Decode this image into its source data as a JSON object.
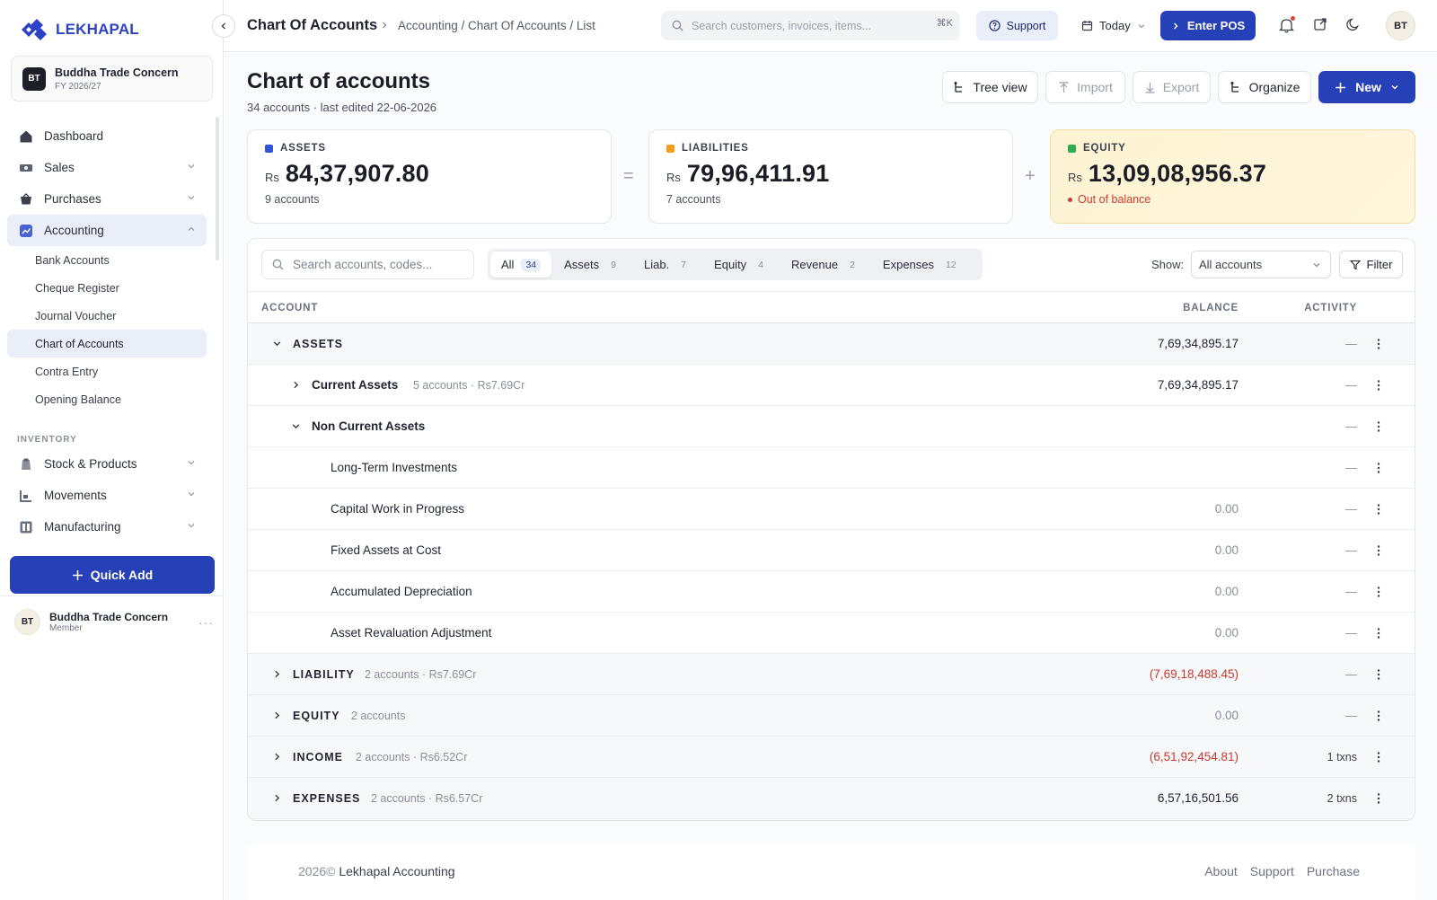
{
  "app": {
    "logo_text": "LEKHAPAL",
    "org_initials": "BT",
    "org_name": "Buddha Trade Concern",
    "fiscal_year": "FY 2026/27"
  },
  "sidebar": {
    "nav": [
      {
        "label": "Dashboard",
        "icon": "home-icon"
      },
      {
        "label": "Sales",
        "icon": "sales-icon"
      },
      {
        "label": "Purchases",
        "icon": "basket-icon"
      },
      {
        "label": "Accounting",
        "icon": "chart-icon"
      }
    ],
    "accounting_sub": [
      "Bank Accounts",
      "Cheque Register",
      "Journal Voucher",
      "Chart of Accounts",
      "Contra Entry",
      "Opening Balance"
    ],
    "section_inventory": "INVENTORY",
    "inventory": [
      {
        "label": "Stock & Products",
        "icon": "box-icon"
      },
      {
        "label": "Movements",
        "icon": "movements-icon"
      },
      {
        "label": "Manufacturing",
        "icon": "factory-icon"
      }
    ],
    "quick_add": "Quick Add",
    "user": {
      "initials": "BT",
      "name": "Buddha Trade Concern",
      "role": "Member",
      "more": "···"
    }
  },
  "topbar": {
    "title": "Chart Of Accounts",
    "path": "Accounting / Chart Of Accounts / List",
    "search_placeholder": "Search customers, invoices, items...",
    "search_shortcut": "⌘K",
    "support": "Support",
    "date_filter": "Today",
    "enter_pos": "Enter POS",
    "avatar": "BT"
  },
  "page": {
    "title": "Chart of accounts",
    "subtitle": "34 accounts · last edited 22-06-2026",
    "buttons": {
      "tree_view": "Tree view",
      "import": "Import",
      "export": "Export",
      "organize": "Organize",
      "new": "New"
    }
  },
  "summary": {
    "currency": "Rs",
    "assets": {
      "label": "ASSETS",
      "amount": "84,37,907.80",
      "sub": "9  accounts",
      "color": "#2f54d6"
    },
    "liabilities": {
      "label": "LIABILITIES",
      "amount": "79,96,411.91",
      "sub": "7  accounts",
      "color": "#f39c1a"
    },
    "equity": {
      "label": "EQUITY",
      "amount": "13,09,08,956.37",
      "warning": "Out of balance",
      "color": "#2fae4e"
    },
    "op_equals": "=",
    "op_plus": "+"
  },
  "table": {
    "search_placeholder": "Search accounts, codes...",
    "tabs": [
      {
        "label": "All",
        "count": "34"
      },
      {
        "label": "Assets",
        "count": "9"
      },
      {
        "label": "Liab.",
        "count": "7"
      },
      {
        "label": "Equity",
        "count": "4"
      },
      {
        "label": "Revenue",
        "count": "2"
      },
      {
        "label": "Expenses",
        "count": "12"
      }
    ],
    "show_label": "Show:",
    "show_value": "All accounts",
    "filter": "Filter",
    "columns": {
      "account": "ACCOUNT",
      "balance": "BALANCE",
      "activity": "ACTIVITY"
    },
    "rows": [
      {
        "name": "ASSETS",
        "meta": "",
        "balance": "7,69,34,895.17",
        "activity": "—"
      },
      {
        "name": "Current Assets",
        "meta": "5 accounts · Rs7.69Cr",
        "balance": "7,69,34,895.17",
        "activity": "—"
      },
      {
        "name": "Non Current Assets",
        "meta": "",
        "balance": "",
        "activity": "—"
      },
      {
        "name": "Long-Term Investments",
        "meta": "",
        "balance": "",
        "activity": "—"
      },
      {
        "name": "Capital Work in Progress",
        "meta": "",
        "balance": "0.00",
        "activity": "—"
      },
      {
        "name": "Fixed Assets at Cost",
        "meta": "",
        "balance": "0.00",
        "activity": "—"
      },
      {
        "name": "Accumulated Depreciation",
        "meta": "",
        "balance": "0.00",
        "activity": "—"
      },
      {
        "name": "Asset Revaluation Adjustment",
        "meta": "",
        "balance": "0.00",
        "activity": "—"
      },
      {
        "name": "LIABILITY",
        "meta": "2 accounts · Rs7.69Cr",
        "balance": "(7,69,18,488.45)",
        "activity": "—"
      },
      {
        "name": "EQUITY",
        "meta": "2 accounts",
        "balance": "0.00",
        "activity": "—"
      },
      {
        "name": "INCOME",
        "meta": "2 accounts · Rs6.52Cr",
        "balance": "(6,51,92,454.81)",
        "activity": "1 txns"
      },
      {
        "name": "EXPENSES",
        "meta": "2 accounts · Rs6.57Cr",
        "balance": "6,57,16,501.56",
        "activity": "2 txns"
      }
    ]
  },
  "footer": {
    "copyright": "2026©",
    "brand": "Lekhapal Accounting",
    "links": [
      "About",
      "Support",
      "Purchase"
    ]
  }
}
